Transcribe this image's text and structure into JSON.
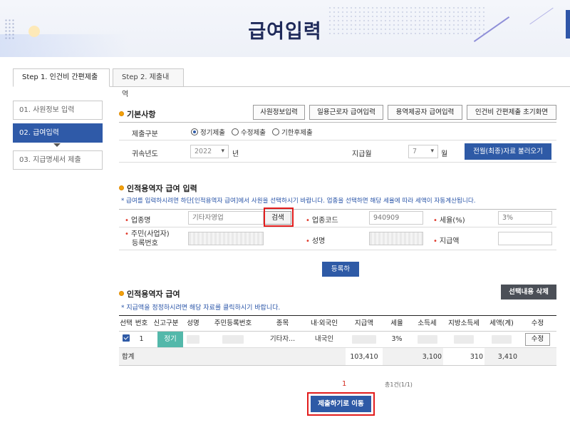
{
  "page": {
    "title": "급여입력"
  },
  "tabs": [
    {
      "label": "Step 1. 인건비 간편제출"
    },
    {
      "label": "Step 2. 제출내역"
    }
  ],
  "steps": [
    {
      "label": "01. 사원정보 입력"
    },
    {
      "label": "02. 급여입력"
    },
    {
      "label": "03. 지급명세서 제출"
    }
  ],
  "basic": {
    "heading": "기본사항",
    "buttons": [
      "사원정보입력",
      "일용근로자 급여입력",
      "용역제공자 급여입력",
      "인건비 간편제출 초기화면"
    ],
    "submit_type_label": "제출구분",
    "submit_options": [
      "정기제출",
      "수정제출",
      "기한후제출"
    ],
    "year_label": "귀속년도",
    "year_value": "2022",
    "year_suffix": "년",
    "month_label": "지급월",
    "month_value": "7",
    "month_suffix": "월",
    "load_button": "전월(최종)자료 불러오기"
  },
  "input": {
    "heading": "인적용역자 급여 입력",
    "note": "* 급여를 입력하시려면 하단[인적용역자 급여]에서 사원을 선택하시기 바랍니다. 업종을 선택하면 해당 세율에 따라 세액이 자동계산됩니다.",
    "industry_label": "업종명",
    "industry_value": "기타자영업",
    "search_button": "검색",
    "code_label": "업종코드",
    "code_value": "940909",
    "rate_label": "세율(%)",
    "rate_value": "3%",
    "id_label_line1": "주민(사업자)",
    "id_label_line2": "등록번호",
    "name_label": "성명",
    "pay_label": "지급액",
    "register_button": "등록하기"
  },
  "list": {
    "heading": "인적용역자 급여",
    "delete_button": "선택내용 삭제",
    "note": "* 지급액을 정정하시려면 해당 자료를 클릭하시기 바랍니다.",
    "columns": [
      "선택",
      "번호",
      "신고구분",
      "성명",
      "주민등록번호",
      "종목",
      "내·외국인",
      "지급액",
      "세율",
      "소득세",
      "지방소득세",
      "세액(계)",
      "수정"
    ],
    "row": {
      "number": "1",
      "report_type": "정기",
      "category": "기타자...",
      "nationality": "내국인",
      "rate": "3%",
      "edit_button": "수정"
    },
    "sum": {
      "label": "합계",
      "pay": "103,410",
      "income_tax": "3,100",
      "local_tax": "310",
      "total_tax": "3,410"
    }
  },
  "pager": {
    "page": "1",
    "total": "총1건(1/1)"
  },
  "footer": {
    "submit_button": "제출하기로 이동"
  }
}
